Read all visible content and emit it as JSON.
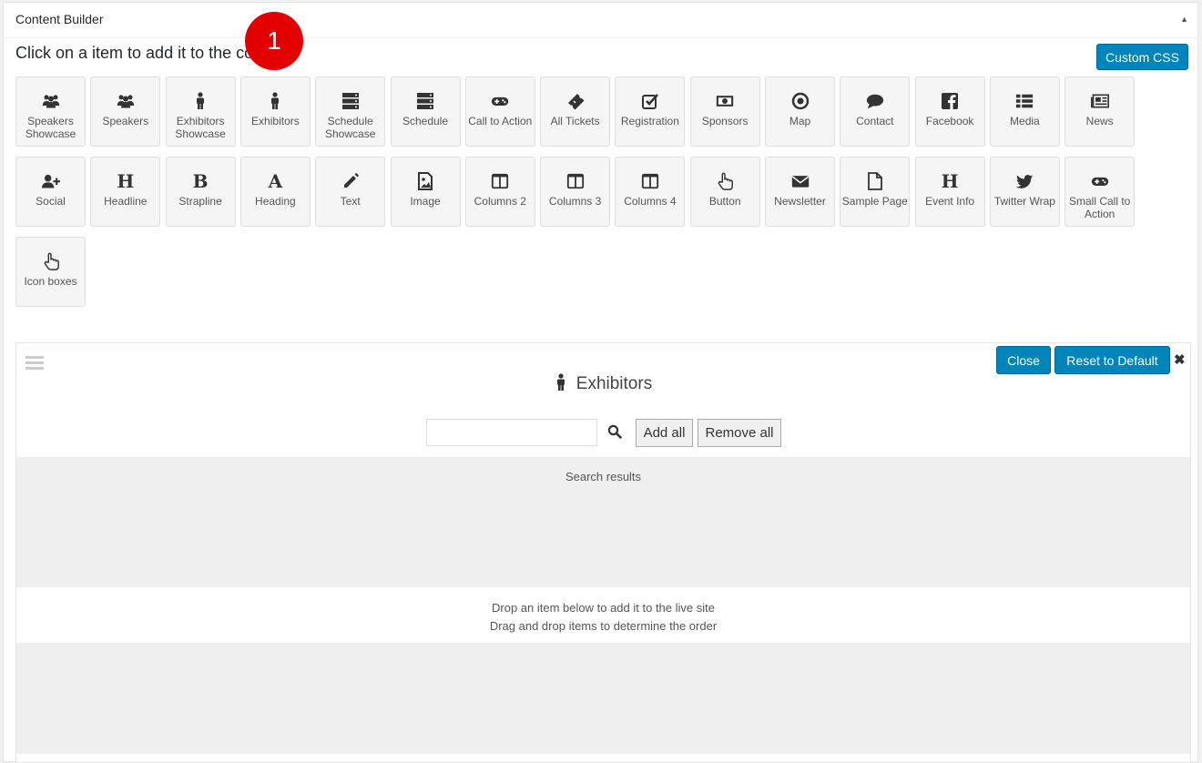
{
  "header": {
    "title": "Content Builder",
    "toggle_icon": "▲"
  },
  "instruction": "Click on a item to add it to the content",
  "custom_css_label": "Custom CSS",
  "annotation_badge": "1",
  "tiles": [
    {
      "label": "Speakers Showcase",
      "icon": "users-icon"
    },
    {
      "label": "Speakers",
      "icon": "users-icon"
    },
    {
      "label": "Exhibitors Showcase",
      "icon": "male-icon"
    },
    {
      "label": "Exhibitors",
      "icon": "male-icon"
    },
    {
      "label": "Schedule Showcase",
      "icon": "server-icon"
    },
    {
      "label": "Schedule",
      "icon": "server-icon"
    },
    {
      "label": "Call to Action",
      "icon": "gamepad-icon"
    },
    {
      "label": "All Tickets",
      "icon": "ticket-icon"
    },
    {
      "label": "Registration",
      "icon": "check-square-icon"
    },
    {
      "label": "Sponsors",
      "icon": "money-icon"
    },
    {
      "label": "Map",
      "icon": "dot-circle-icon"
    },
    {
      "label": "Contact",
      "icon": "comment-icon"
    },
    {
      "label": "Facebook",
      "icon": "facebook-icon"
    },
    {
      "label": "Media",
      "icon": "list-icon"
    },
    {
      "label": "News",
      "icon": "newspaper-icon"
    },
    {
      "label": "Social",
      "icon": "user-plus-icon"
    },
    {
      "label": "Headline",
      "icon": "headline-h-icon",
      "glyph": "H"
    },
    {
      "label": "Strapline",
      "icon": "strapline-b-icon",
      "glyph": "B"
    },
    {
      "label": "Heading",
      "icon": "heading-a-icon",
      "glyph": "A"
    },
    {
      "label": "Text",
      "icon": "pencil-icon"
    },
    {
      "label": "Image",
      "icon": "image-icon"
    },
    {
      "label": "Columns 2",
      "icon": "columns-icon"
    },
    {
      "label": "Columns 3",
      "icon": "columns-icon"
    },
    {
      "label": "Columns 4",
      "icon": "columns-icon"
    },
    {
      "label": "Button",
      "icon": "hand-pointer-icon"
    },
    {
      "label": "Newsletter",
      "icon": "envelope-icon"
    },
    {
      "label": "Sample Page",
      "icon": "file-icon"
    },
    {
      "label": "Event Info",
      "icon": "event-info-h-icon",
      "glyph": "H"
    },
    {
      "label": "Twitter Wrap",
      "icon": "twitter-icon"
    },
    {
      "label": "Small Call to Action",
      "icon": "gamepad-icon"
    },
    {
      "label": "Icon boxes",
      "icon": "hand-pointer-icon"
    }
  ],
  "panel": {
    "close_label": "Close",
    "reset_label": "Reset to Default",
    "remove_icon": "✖",
    "title": "Exhibitors",
    "search": {
      "value": "",
      "placeholder": ""
    },
    "add_all_label": "Add all",
    "remove_all_label": "Remove all",
    "search_results_label": "Search results",
    "drop_text_1": "Drop an item below to add it to the live site",
    "drop_text_2": "Drag and drop items to determine the order"
  },
  "colors": {
    "primary": "#0085ba",
    "badge": "#e30000",
    "tile_bg": "#f5f5f5"
  }
}
